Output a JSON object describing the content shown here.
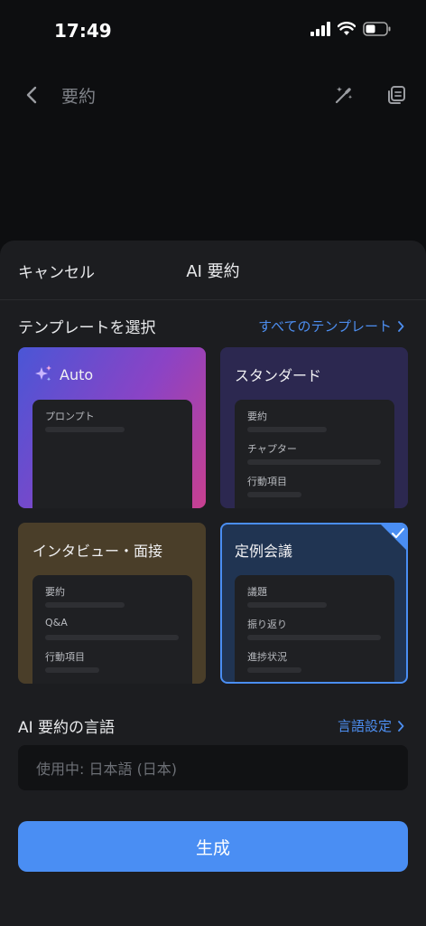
{
  "status_bar": {
    "time": "17:49"
  },
  "nav": {
    "title": "要約",
    "back_icon": "chevron-left-icon",
    "magic_icon": "magic-wand-icon",
    "copy_icon": "copy-icon"
  },
  "sheet": {
    "cancel_label": "キャンセル",
    "title": "AI 要約",
    "template_section": {
      "label": "テンプレートを選択",
      "link": "すべてのテンプレート"
    },
    "templates": [
      {
        "title": "Auto",
        "lines": [
          "プロンプト"
        ],
        "selected": false
      },
      {
        "title": "スタンダード",
        "lines": [
          "要約",
          "チャプター",
          "行動項目"
        ],
        "selected": false
      },
      {
        "title": "インタビュー・面接",
        "lines": [
          "要約",
          "Q&A",
          "行動項目"
        ],
        "selected": false
      },
      {
        "title": "定例会議",
        "lines": [
          "議題",
          "振り返り",
          "進捗状況"
        ],
        "selected": true
      }
    ],
    "language_section": {
      "label": "AI 要約の言語",
      "link": "言語設定"
    },
    "language_value": "使用中: 日本語 (日本)",
    "generate_label": "生成"
  },
  "colors": {
    "accent": "#4a8ef3",
    "sheet_bg": "#1c1d20"
  }
}
